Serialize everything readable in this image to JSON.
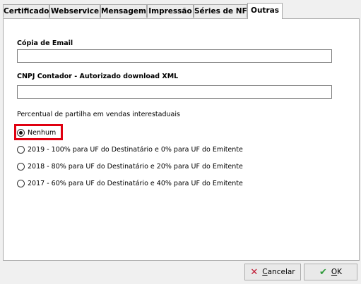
{
  "tabs": [
    {
      "label": "Certificado"
    },
    {
      "label": "Webservice"
    },
    {
      "label": "Mensagem"
    },
    {
      "label": "Impressão"
    },
    {
      "label": "Séries de NFe"
    },
    {
      "label": "Outras",
      "active": true
    }
  ],
  "form": {
    "copia_email_label": "Cópia de  Email",
    "copia_email_value": "",
    "cnpj_label": "CNPJ Contador - Autorizado download XML",
    "cnpj_value": "",
    "partilha_label": "Percentual de partilha em vendas interestaduais",
    "partilha_options": [
      {
        "label": "Nenhum",
        "checked": true
      },
      {
        "label": "2019 - 100% para UF do Destinatário e 0% para UF do Emitente",
        "checked": false
      },
      {
        "label": "2018 - 80% para UF do Destinatário e 20% para UF do Emitente",
        "checked": false
      },
      {
        "label": "2017 - 60% para UF do Destinatário e 40% para UF do Emitente",
        "checked": false
      }
    ]
  },
  "buttons": {
    "cancel_underlined": "C",
    "cancel_rest": "ancelar",
    "ok_underlined": "O",
    "ok_rest": "K"
  },
  "icons": {
    "cancel": "x-icon",
    "ok": "check-icon"
  },
  "colors": {
    "highlight": "#e00010",
    "cancel_icon": "#c0152f",
    "ok_icon": "#2e9a3a"
  }
}
